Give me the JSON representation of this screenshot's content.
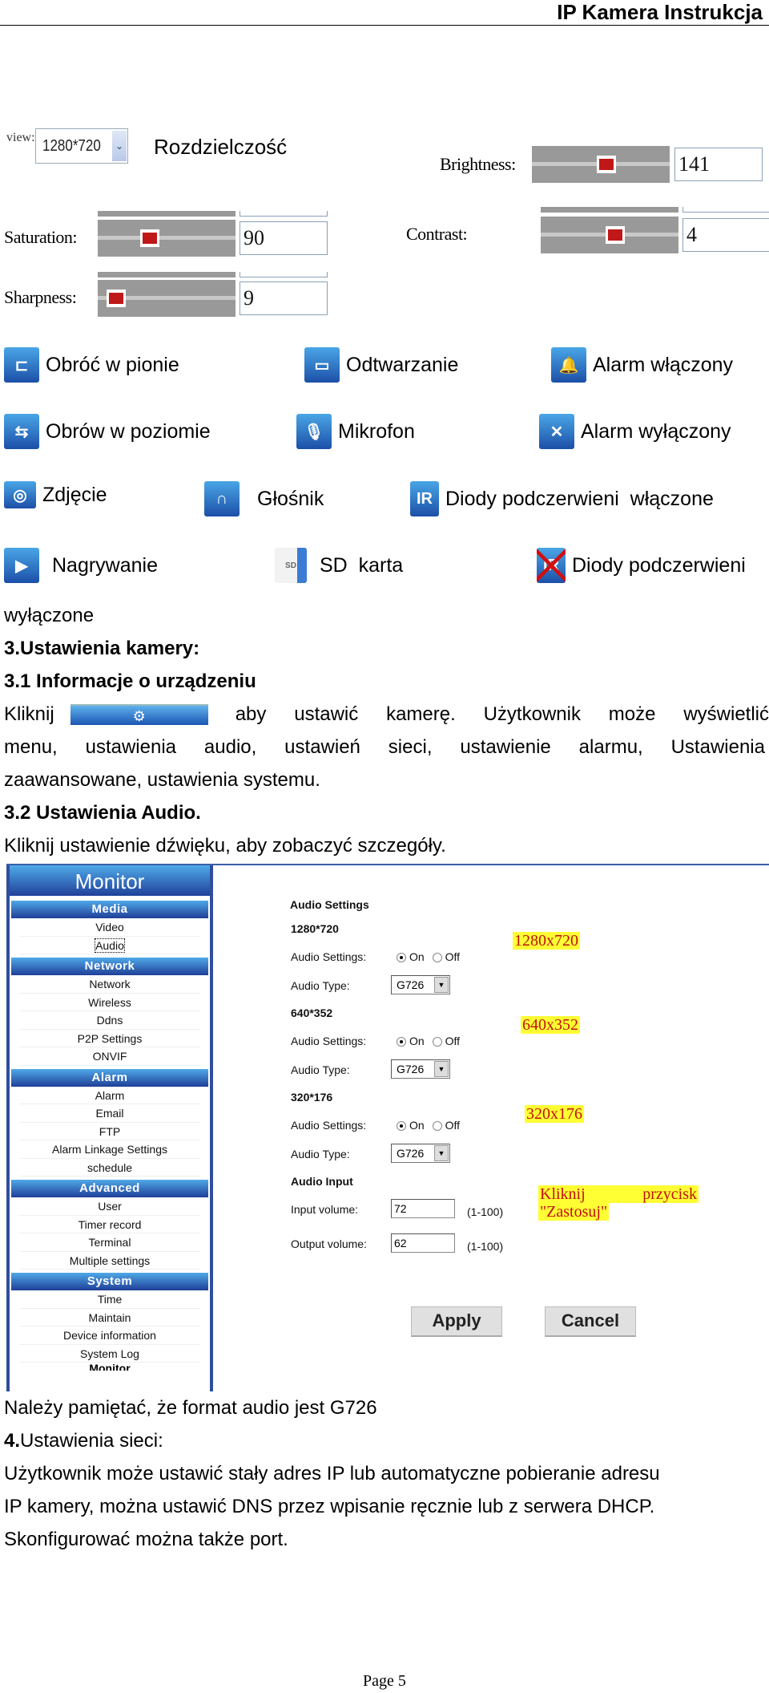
{
  "header": {
    "title": "IP Kamera Instrukcja"
  },
  "resolution": {
    "view_label": "view:",
    "view_value": "1280*720",
    "caption": "Rozdzielczość"
  },
  "image_controls": [
    {
      "label": "Brightness:",
      "value": "141",
      "level": 0.55
    },
    {
      "label": "Saturation:",
      "value": "90",
      "level": 0.35
    },
    {
      "label": "Contrast:",
      "value": "4",
      "level": 0.55
    },
    {
      "label": "Sharpness:",
      "value": "9",
      "level": 0.05
    }
  ],
  "legend": [
    {
      "icon": "flip-vertical-icon",
      "glyph": "⊏",
      "label": "Obróć w pionie"
    },
    {
      "icon": "playback-icon",
      "glyph": "▭",
      "label": "Odtwarzanie"
    },
    {
      "icon": "alarm-on-icon",
      "glyph": "🔔",
      "label": "Alarm włączony"
    },
    {
      "icon": "mirror-horizontal-icon",
      "glyph": "⇆",
      "label": "Obrów w poziomie"
    },
    {
      "icon": "microphone-icon",
      "glyph": "🎙",
      "label": "Mikrofon"
    },
    {
      "icon": "alarm-off-icon",
      "glyph": "✕",
      "label": "Alarm wyłączony"
    },
    {
      "icon": "camera-snapshot-icon",
      "glyph": "◎",
      "label": "Zdjęcie"
    },
    {
      "icon": "headphones-icon",
      "glyph": "∩",
      "label": "Głośnik"
    },
    {
      "icon": "ir-on-icon",
      "glyph": "IR",
      "label": "Diody podczerwieni  włączone"
    },
    {
      "icon": "video-record-icon",
      "glyph": "▶",
      "label": "Nagrywanie"
    },
    {
      "icon": "sd-card-icon",
      "glyph": "SD",
      "label": "SD  karta"
    },
    {
      "icon": "ir-off-icon",
      "glyph": "IR",
      "label": "Diody podczerwieni"
    }
  ],
  "text": {
    "wrap_continuation": "wyłączone",
    "section3": "3.Ustawienia kamery:",
    "section3_1": "3.1 Informacje o urządzeniu",
    "p1_start": "Kliknij",
    "p1_line1": "aby  ustawić  kamerę.  Użytkownik  może  wyświetlić",
    "p1_line2": "menu,  ustawienia  audio,  ustawień  sieci,  ustawienie  alarmu,  Ustawienia",
    "p1_line3": "zaawansowane, ustawienia systemu.",
    "section3_2": "3.2 Ustawienia Audio.",
    "p2": "Kliknij ustawienie dźwięku, aby zobaczyć szczegóły.",
    "note_g726": "Należy pamiętać, że format audio jest G726",
    "section4_num": "4.",
    "section4_title": "Ustawienia sieci:",
    "p3_line1": "Użytkownik może ustawić stały adres IP lub automatyczne pobieranie adresu",
    "p3_line2": "IP kamery, można ustawić DNS przez wpisanie ręcznie lub z serwera DHCP.",
    "p3_line3": "Skonfigurować można także port."
  },
  "sidebar": {
    "title": "Monitor",
    "groups": [
      {
        "name": "Media",
        "items": [
          "Video",
          "Audio"
        ]
      },
      {
        "name": "Network",
        "items": [
          "Network",
          "Wireless",
          "Ddns",
          "P2P Settings",
          "ONVIF"
        ]
      },
      {
        "name": "Alarm",
        "items": [
          "Alarm",
          "Email",
          "FTP",
          "Alarm Linkage Settings",
          "schedule"
        ]
      },
      {
        "name": "Advanced",
        "items": [
          "User",
          "Timer record",
          "Terminal",
          "Multiple settings"
        ]
      },
      {
        "name": "System",
        "items": [
          "Time",
          "Maintain",
          "Device information",
          "System Log"
        ]
      }
    ],
    "cut_item": "Monitor",
    "selected": "Audio"
  },
  "audio_form": {
    "title": "Audio Settings",
    "streams": [
      {
        "name": "1280*720",
        "settings_label": "Audio Settings:",
        "on": "On",
        "off": "Off",
        "enabled": true,
        "type_label": "Audio Type:",
        "type": "G726",
        "annotation": "1280x720"
      },
      {
        "name": "640*352",
        "settings_label": "Audio Settings:",
        "on": "On",
        "off": "Off",
        "enabled": true,
        "type_label": "Audio Type:",
        "type": "G726",
        "annotation": "640x352"
      },
      {
        "name": "320*176",
        "settings_label": "Audio Settings:",
        "on": "On",
        "off": "Off",
        "enabled": true,
        "type_label": "Audio Type:",
        "type": "G726",
        "annotation": "320x176"
      }
    ],
    "input_title": "Audio Input",
    "input_label": "Input volume:",
    "input_value": "72",
    "output_label": "Output volume:",
    "output_value": "62",
    "range": "(1-100)",
    "apply_note_line1_a": "Kliknij",
    "apply_note_line1_b": "przycisk",
    "apply_note_line2": "\"Zastosuj\"",
    "apply": "Apply",
    "cancel": "Cancel"
  },
  "footer": {
    "page": "Page 5"
  }
}
